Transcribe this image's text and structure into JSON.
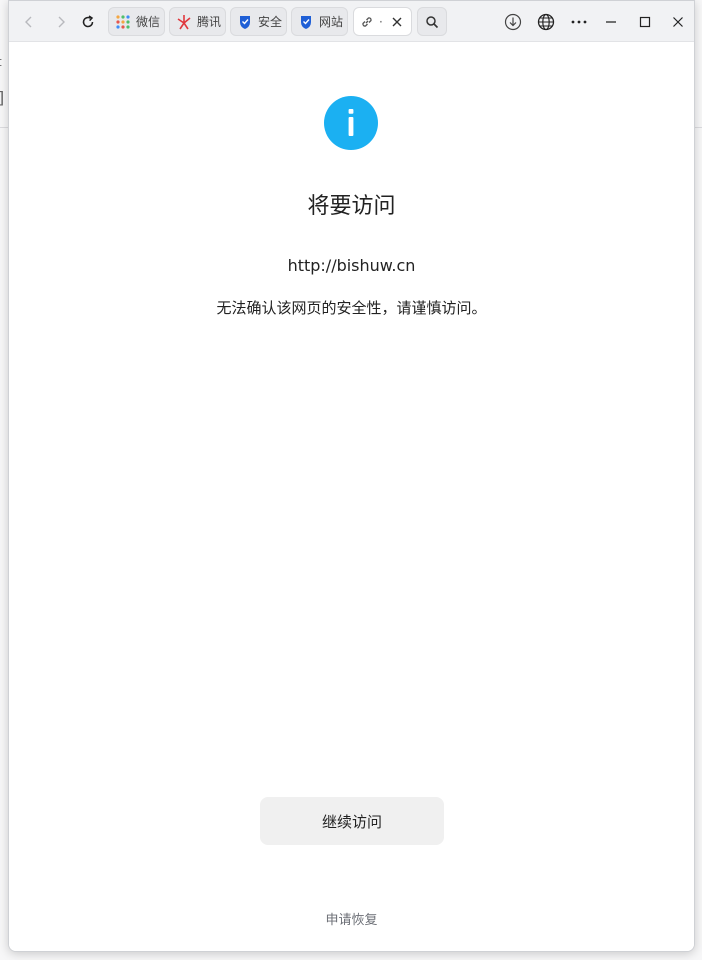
{
  "browser": {
    "tabs": [
      {
        "label": "微信",
        "icon": "wechat-grid-icon",
        "active": false
      },
      {
        "label": "腾讯",
        "icon": "tencent-star-icon",
        "active": false
      },
      {
        "label": "安全",
        "icon": "security-shield-icon",
        "active": false
      },
      {
        "label": "网站",
        "icon": "security-shield-icon",
        "active": false
      },
      {
        "label": "·",
        "icon": "link-icon",
        "active": true
      }
    ]
  },
  "page": {
    "title": "将要访问",
    "url": "http://bishuw.cn",
    "warning": "无法确认该网页的安全性，请谨慎访问。",
    "continue_label": "继续访问",
    "restore_label": "申请恢复"
  },
  "colors": {
    "info_icon": "#1bb0f2",
    "button_bg": "#f0f0f0",
    "link_text": "#6b6e75"
  }
}
